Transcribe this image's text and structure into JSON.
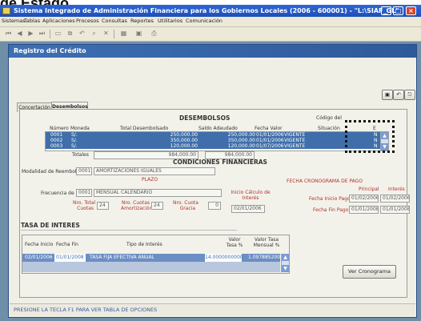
{
  "heading": "de Estado",
  "app": {
    "title": "Sistema Integrado de Administración Financiera para los Gobiernos Locales (2006 - 600001) - \"L:\\SIAF_GL\"",
    "menu": [
      "Sistemas",
      "Tablas",
      "Aplicaciones",
      "Procesos",
      "Consultas",
      "Reportes",
      "Utilitarios",
      "Comunicación"
    ]
  },
  "window": {
    "title": "Registro del Crédito",
    "tabs": [
      "Concertación",
      "Desembolsos"
    ]
  },
  "desembolsos": {
    "title": "DESEMBOLSOS",
    "codigo_label": "Código del",
    "headers": [
      "Número",
      "Moneda",
      "Total Desembolsado",
      "Saldo Adeudado",
      "Fecha Valor",
      "Situación",
      "E"
    ],
    "rows": [
      {
        "numero": "0001",
        "moneda": "S/.",
        "total": "250,000.00",
        "saldo": "250,000.00",
        "fecha": "01/01/2006",
        "situacion": "VIGENTE",
        "e": "N"
      },
      {
        "numero": "0002",
        "moneda": "S/.",
        "total": "350,000.00",
        "saldo": "350,000.00",
        "fecha": "01/01/2006",
        "situacion": "VIGENTE",
        "e": "N"
      },
      {
        "numero": "0003",
        "moneda": "S/.",
        "total": "120,000.00",
        "saldo": "120,000.00",
        "fecha": "01/07/2006",
        "situacion": "VIGENTE",
        "e": "N"
      }
    ],
    "totales_label": "Totales",
    "total_desembolsado": "984,000.00",
    "total_saldo": "984,000.00"
  },
  "condiciones": {
    "title": "CONDICIONES FINANCIERAS",
    "modalidad_label": "Modalidad de Reembolso",
    "modalidad_code": "0001",
    "modalidad_value": "AMORTIZACIONES IGUALES",
    "plazo_label": "PLAZO",
    "frecuencia_label": "Frecuencia de Pago",
    "frecuencia_code": "0001",
    "frecuencia_value": "MENSUAL CALENDARIO",
    "nro_total_label_1": "Nro. Total",
    "nro_total_label_2": "Cuotas",
    "nro_total_value": "24",
    "nro_cuotas_label_1": "Nro. Cuotas",
    "nro_cuotas_label_2": "Amortización",
    "nro_cuotas_value": "24",
    "nro_cuota_label_1": "Nro. Cuota",
    "nro_cuota_label_2": "Gracia",
    "nro_cuota_value": "0",
    "inicio_label_1": "Inicio Cálculo de",
    "inicio_label_2": "Interés",
    "inicio_value": "02/01/2006",
    "cronograma_title": "FECHA CRONOGRAMA DE PAGO",
    "principal_label": "Principal",
    "interes_label": "Interés",
    "fecha_inicio_pago_label": "Fecha Inicio Pago",
    "fecha_inicio_pago_principal": "01/02/2006",
    "fecha_inicio_pago_interes": "01/02/2006",
    "fecha_fin_pago_label": "Fecha Fin Pago",
    "fecha_fin_pago_principal": "01/01/2008",
    "fecha_fin_pago_interes": "01/01/2008"
  },
  "tasa": {
    "title": "TASA DE INTERES",
    "headers": {
      "fecha_inicio": "Fecha Inicio",
      "fecha_fin": "Fecha Fin",
      "tipo": "Tipo de Interés",
      "valor_tasa_1": "Valor",
      "valor_tasa_2": "Tasa %",
      "valor_mensual_1": "Valor Tasa",
      "valor_mensual_2": "Mensual %"
    },
    "row": {
      "fecha_inicio": "02/01/2006",
      "fecha_fin": "01/01/2008",
      "tipo": "TASA FIJA EFECTIVA ANUAL",
      "valor": "14.0000000000",
      "mensual": "1.0978852000"
    }
  },
  "ver_cronograma_label": "Ver Cronograma",
  "status_text": "PRESIONE LA TECLA F1 PARA VER TABLA DE OPCIONES"
}
